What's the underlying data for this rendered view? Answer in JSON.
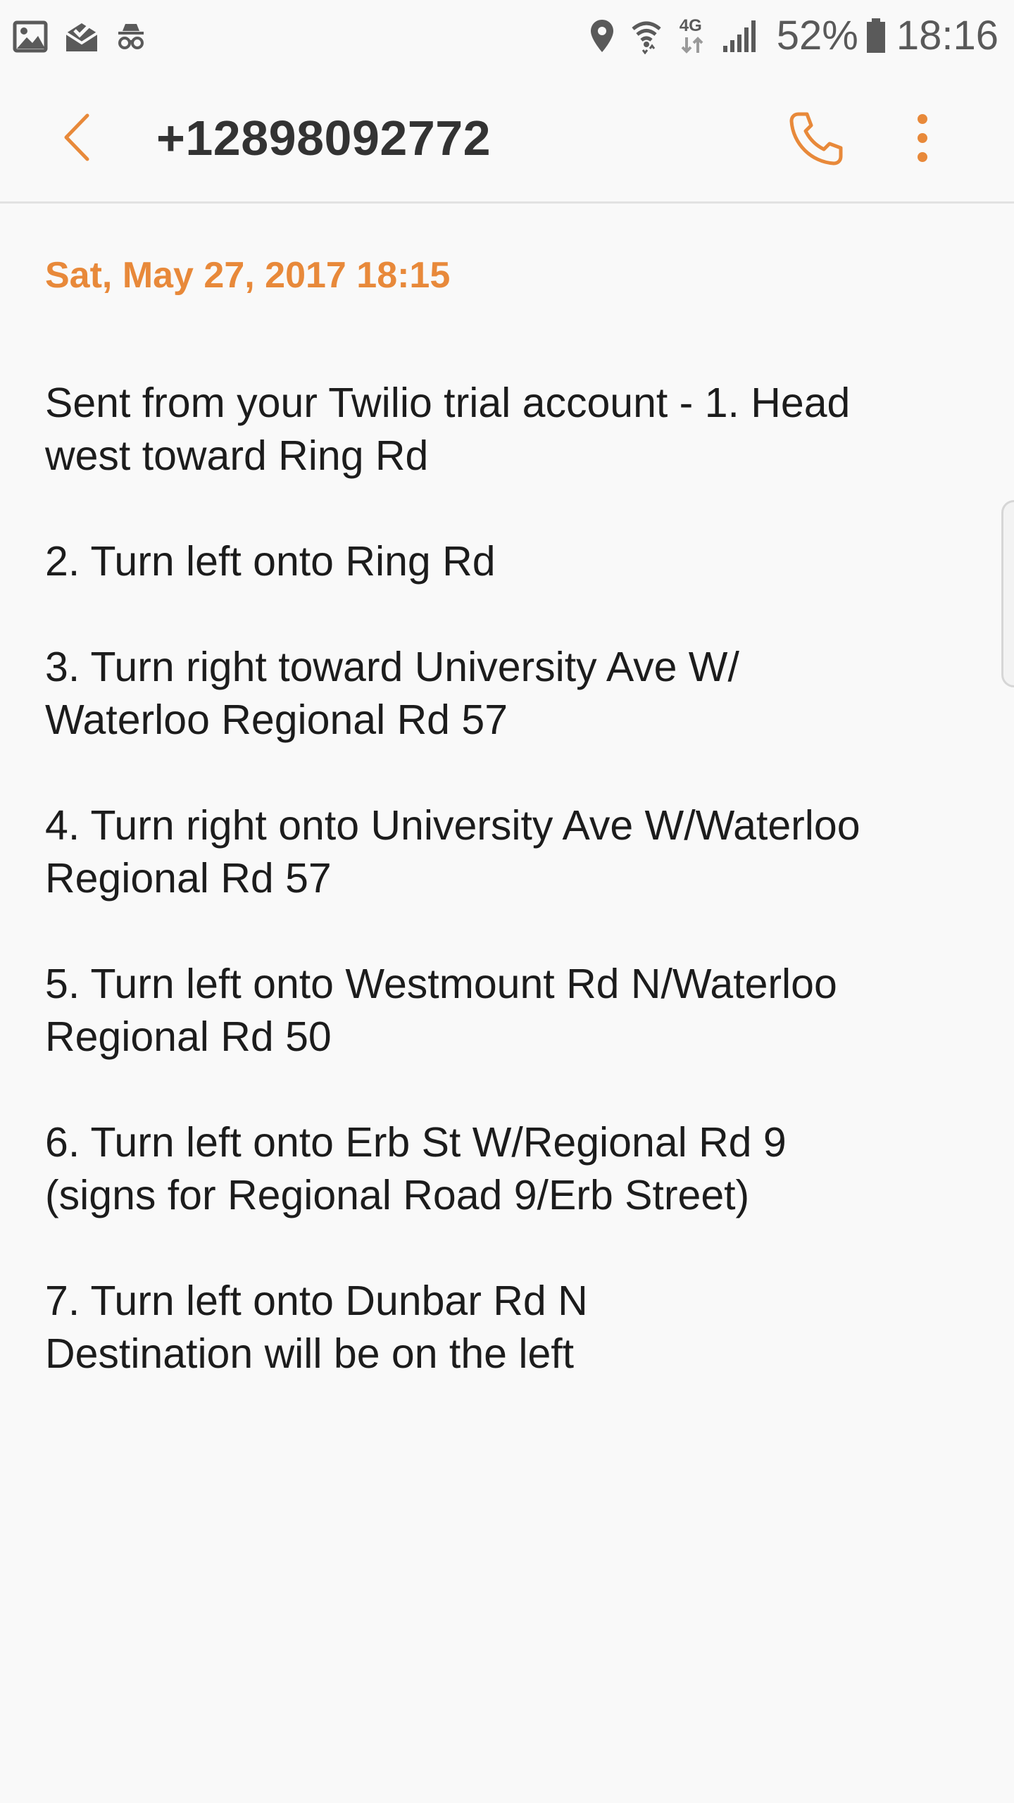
{
  "status_bar": {
    "left_icons": [
      "gallery-icon",
      "mail-check-icon",
      "incognito-icon"
    ],
    "right_icons": [
      "location-icon",
      "wifi-icon",
      "network-4g-icon",
      "signal-icon",
      "battery-icon"
    ],
    "network_label": "4G",
    "battery": "52%",
    "time": "18:16"
  },
  "header": {
    "back_icon": "chevron-left-icon",
    "title": "+12898092772",
    "call_icon": "phone-icon",
    "more_icon": "more-vertical-icon"
  },
  "colors": {
    "accent": "#e8893a",
    "text": "#1c1c1c",
    "title": "#333333",
    "background": "#f9f9f9"
  },
  "conversation": {
    "date": "Sat, May 27, 2017 18:15",
    "message_paragraphs": [
      [
        "Sent from your Twilio trial account - 1. Head",
        "west toward Ring Rd"
      ],
      [
        "2. Turn left onto Ring Rd"
      ],
      [
        "3. Turn right toward University Ave W/",
        "Waterloo Regional Rd 57"
      ],
      [
        "4. Turn right onto University Ave W/Waterloo",
        "Regional Rd 57"
      ],
      [
        "5. Turn left onto Westmount Rd N/Waterloo",
        "Regional Rd 50"
      ],
      [
        "6. Turn left onto Erb St W/Regional Rd 9",
        "(signs for Regional Road 9/Erb Street)"
      ],
      [
        "7. Turn left onto Dunbar Rd N",
        "Destination will be on the left"
      ]
    ]
  }
}
